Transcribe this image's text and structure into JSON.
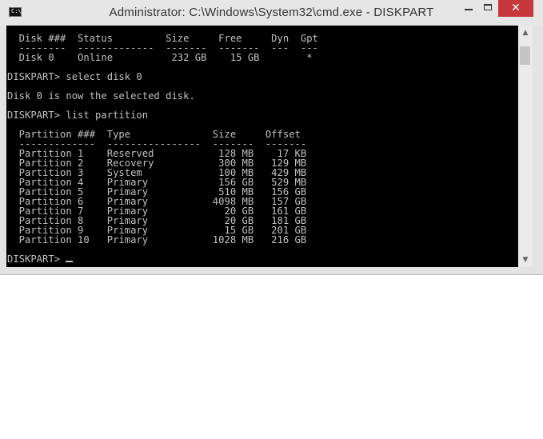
{
  "window": {
    "title": "Administrator: C:\\Windows\\System32\\cmd.exe - DISKPART",
    "icon_label": "C:\\",
    "close_glyph": "✕"
  },
  "console": {
    "lines": [
      "  Disk ###  Status         Size     Free     Dyn  Gpt",
      "  --------  -------------  -------  -------  ---  ---",
      "  Disk 0    Online          232 GB    15 GB        *",
      "",
      "DISKPART> select disk 0",
      "",
      "Disk 0 is now the selected disk.",
      "",
      "DISKPART> list partition",
      "",
      "  Partition ###  Type              Size     Offset",
      "  -------------  ----------------  -------  -------",
      "  Partition 1    Reserved           128 MB    17 KB",
      "  Partition 2    Recovery           300 MB   129 MB",
      "  Partition 3    System             100 MB   429 MB",
      "  Partition 4    Primary            156 GB   529 MB",
      "  Partition 5    Primary            510 MB   156 GB",
      "  Partition 6    Primary           4098 MB   157 GB",
      "  Partition 7    Primary             20 GB   161 GB",
      "  Partition 8    Primary             20 GB   181 GB",
      "  Partition 9    Primary             15 GB   201 GB",
      "  Partition 10   Primary           1028 MB   216 GB",
      "",
      "DISKPART> "
    ]
  },
  "colors": {
    "console_bg": "#000000",
    "console_fg": "#c0c0c0",
    "close_button": "#c7383c",
    "titlebar": "#e6e6e6"
  },
  "icons": {
    "app": "cmd-app-icon",
    "minimize": "minimize-icon",
    "maximize": "maximize-icon",
    "close": "close-icon",
    "scroll_up": "chevron-up-icon",
    "scroll_down": "chevron-down-icon"
  }
}
